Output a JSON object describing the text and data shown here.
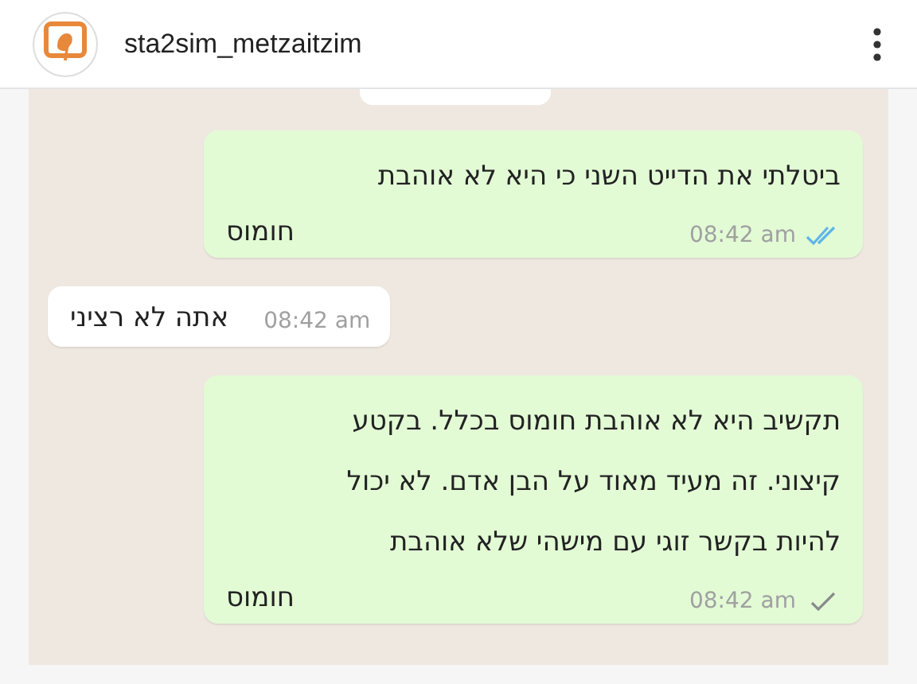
{
  "post_header": {
    "username": "sta2sim_metzaitzim"
  },
  "messages": [
    {
      "kind": "outgoing",
      "lines": [
        "ביטלתי את הדייט השני כי היא לא אוהבת"
      ],
      "tail": "חומוס",
      "time": "08:42 am",
      "read": true
    },
    {
      "kind": "incoming",
      "tail": "אתה לא רציני",
      "time": "08:42 am"
    },
    {
      "kind": "outgoing",
      "lines": [
        "תקשיב היא לא אוהבת חומוס בכלל. בקטע",
        "קיצוני. זה מעיד מאוד על הבן אדם. לא יכול",
        "להיות בקשר זוגי עם מישהי שלא אוהבת"
      ],
      "tail": "חומוס",
      "time": "08:42 am",
      "read": false
    }
  ]
}
